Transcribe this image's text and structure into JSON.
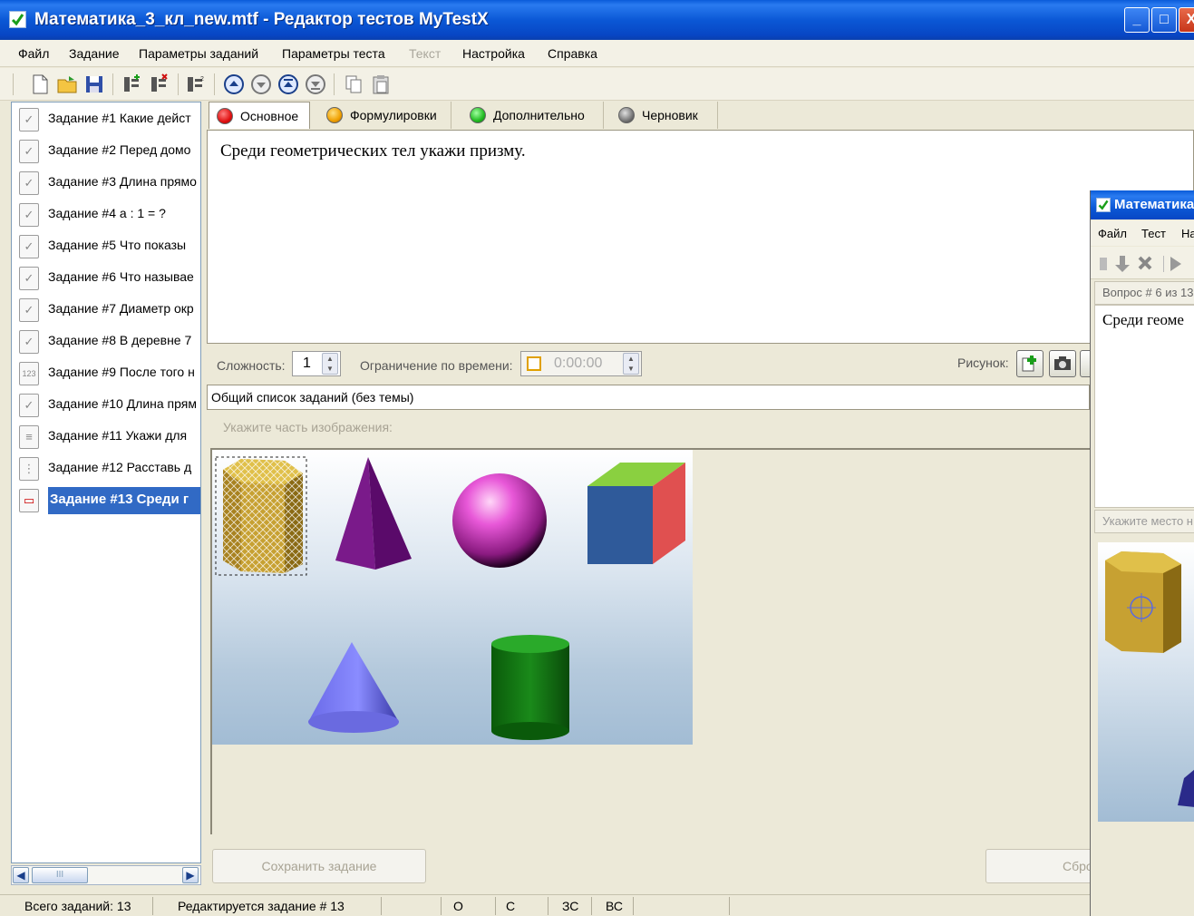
{
  "window": {
    "title": "Математика_3_кл_new.mtf - Редактор тестов MyTestX",
    "buttons": {
      "minimize": "_",
      "maximize": "□",
      "close": "X"
    }
  },
  "menu": [
    "Файл",
    "Задание",
    "Параметры заданий",
    "Параметры теста",
    "Текст",
    "Настройка",
    "Справка"
  ],
  "sidebar": {
    "tasks": [
      {
        "label": "Задание #1 Какие дейст",
        "icon": "check-icon"
      },
      {
        "label": "Задание #2 Перед домо",
        "icon": "check-icon"
      },
      {
        "label": "Задание #3 Длина прямо",
        "icon": "check-icon"
      },
      {
        "label": "Задание #4 а : 1 = ?",
        "icon": "check-icon"
      },
      {
        "label": "Задание #5 Что показы",
        "icon": "check-icon"
      },
      {
        "label": "Задание #6 Что называе",
        "icon": "check-icon"
      },
      {
        "label": "Задание #7 Диаметр окр",
        "icon": "check-icon"
      },
      {
        "label": "Задание #8 В деревне 7",
        "icon": "check-icon"
      },
      {
        "label": "Задание #9 После того н",
        "icon": "number-icon"
      },
      {
        "label": "Задание #10 Длина прям",
        "icon": "check-icon"
      },
      {
        "label": "Задание #11 Укажи для",
        "icon": "list-icon"
      },
      {
        "label": "Задание #12 Расставь д",
        "icon": "order-icon"
      },
      {
        "label": "Задание #13 Среди г",
        "icon": "area-icon"
      }
    ],
    "scroll_grip": "III"
  },
  "tabs": [
    {
      "label": "Основное",
      "color": "#e01010"
    },
    {
      "label": "Формулировки",
      "color": "#f0a000"
    },
    {
      "label": "Дополнительно",
      "color": "#22bb22"
    },
    {
      "label": "Черновик",
      "color": "#777777"
    }
  ],
  "question": {
    "text": "Среди геометрических тел укажи призму."
  },
  "settings": {
    "difficulty_label": "Сложность:",
    "difficulty_value": "1",
    "time_limit_label": "Ограничение по времени:",
    "time_value": "0:00:00",
    "picture_label": "Рисунок:"
  },
  "topic": "Общий список заданий (без темы)",
  "hint": "Укажите часть изображения:",
  "buttons": {
    "save": "Сохранить задание",
    "reset": "Сбро"
  },
  "status": {
    "total": "Всего заданий: 13",
    "editing": "Редактируется задание # 13",
    "cells": [
      "О",
      "С",
      "ЗС",
      "ВС"
    ]
  },
  "preview": {
    "title": "Математика",
    "menu": [
      "Файл",
      "Тест",
      "На"
    ],
    "question_number": "Вопрос # 6 из 13",
    "question_text": "Среди геоме",
    "hint": "Укажите место н"
  },
  "colors": {
    "selection": "#316ac5",
    "titlebar": "#0b58d6",
    "window_bg": "#ece9d8"
  }
}
